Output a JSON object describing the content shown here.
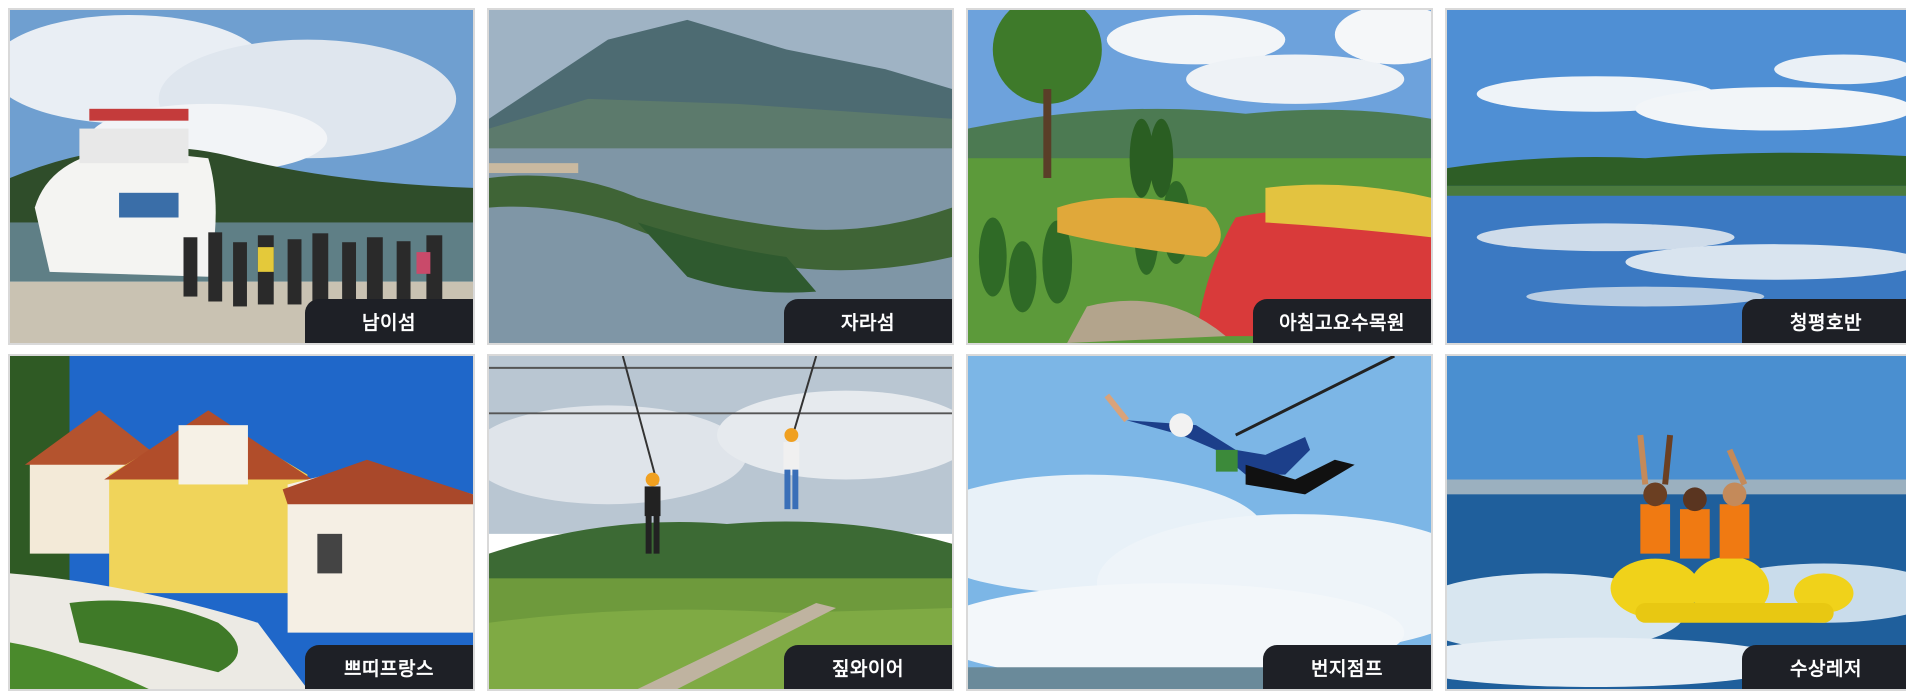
{
  "tiles": [
    {
      "label": "남이섬",
      "scene": "ferry-island-photo"
    },
    {
      "label": "자라섬",
      "scene": "river-island-photo"
    },
    {
      "label": "아침고요수목원",
      "scene": "arboretum-garden-photo"
    },
    {
      "label": "청평호반",
      "scene": "lake-reflection-photo"
    },
    {
      "label": "쁘띠프랑스",
      "scene": "french-village-photo"
    },
    {
      "label": "짚와이어",
      "scene": "zipwire-photo"
    },
    {
      "label": "번지점프",
      "scene": "bungee-jump-photo"
    },
    {
      "label": "수상레저",
      "scene": "banana-boat-photo"
    }
  ]
}
